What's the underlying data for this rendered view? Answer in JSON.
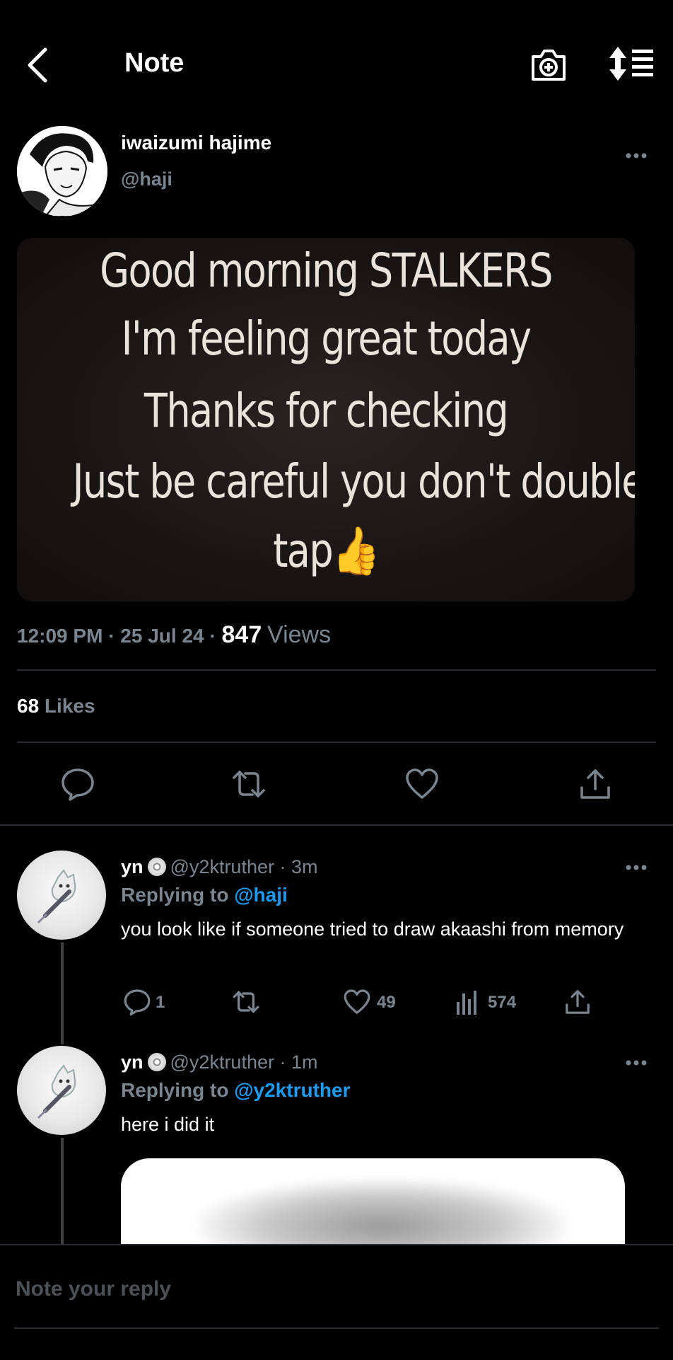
{
  "header": {
    "title": "Note",
    "back_icon": "chevron-left-icon",
    "camera_icon": "camera-plus-icon",
    "sort_icon": "sort-list-icon"
  },
  "post": {
    "author_name": "iwaizumi hajime",
    "author_handle": "@haji",
    "image_text": [
      "Good morning STALKERS",
      "I'm feeling great today",
      "Thanks for checking",
      "Just be careful you don't double",
      "tap👍"
    ],
    "time": "12:09 PM",
    "date": "25 Jul 24",
    "views_count": "847",
    "views_label": "Views",
    "likes_count": "68",
    "likes_label": "Likes"
  },
  "replies": [
    {
      "name": "yn",
      "handle": "@y2ktruther",
      "time": "3m",
      "replying_label": "Replying to",
      "replying_to": "@haji",
      "text": "you look like if someone tried to draw akaashi from memory",
      "reply_count": "1",
      "like_count": "49",
      "view_count": "574"
    },
    {
      "name": "yn",
      "handle": "@y2ktruther",
      "time": "1m",
      "replying_label": "Replying to",
      "replying_to": "@y2ktruther",
      "text": "here i did it"
    }
  ],
  "composer": {
    "placeholder": "Note your reply"
  },
  "colors": {
    "background": "#000000",
    "accent": "#1d9bf0",
    "muted": "#7b8590"
  }
}
